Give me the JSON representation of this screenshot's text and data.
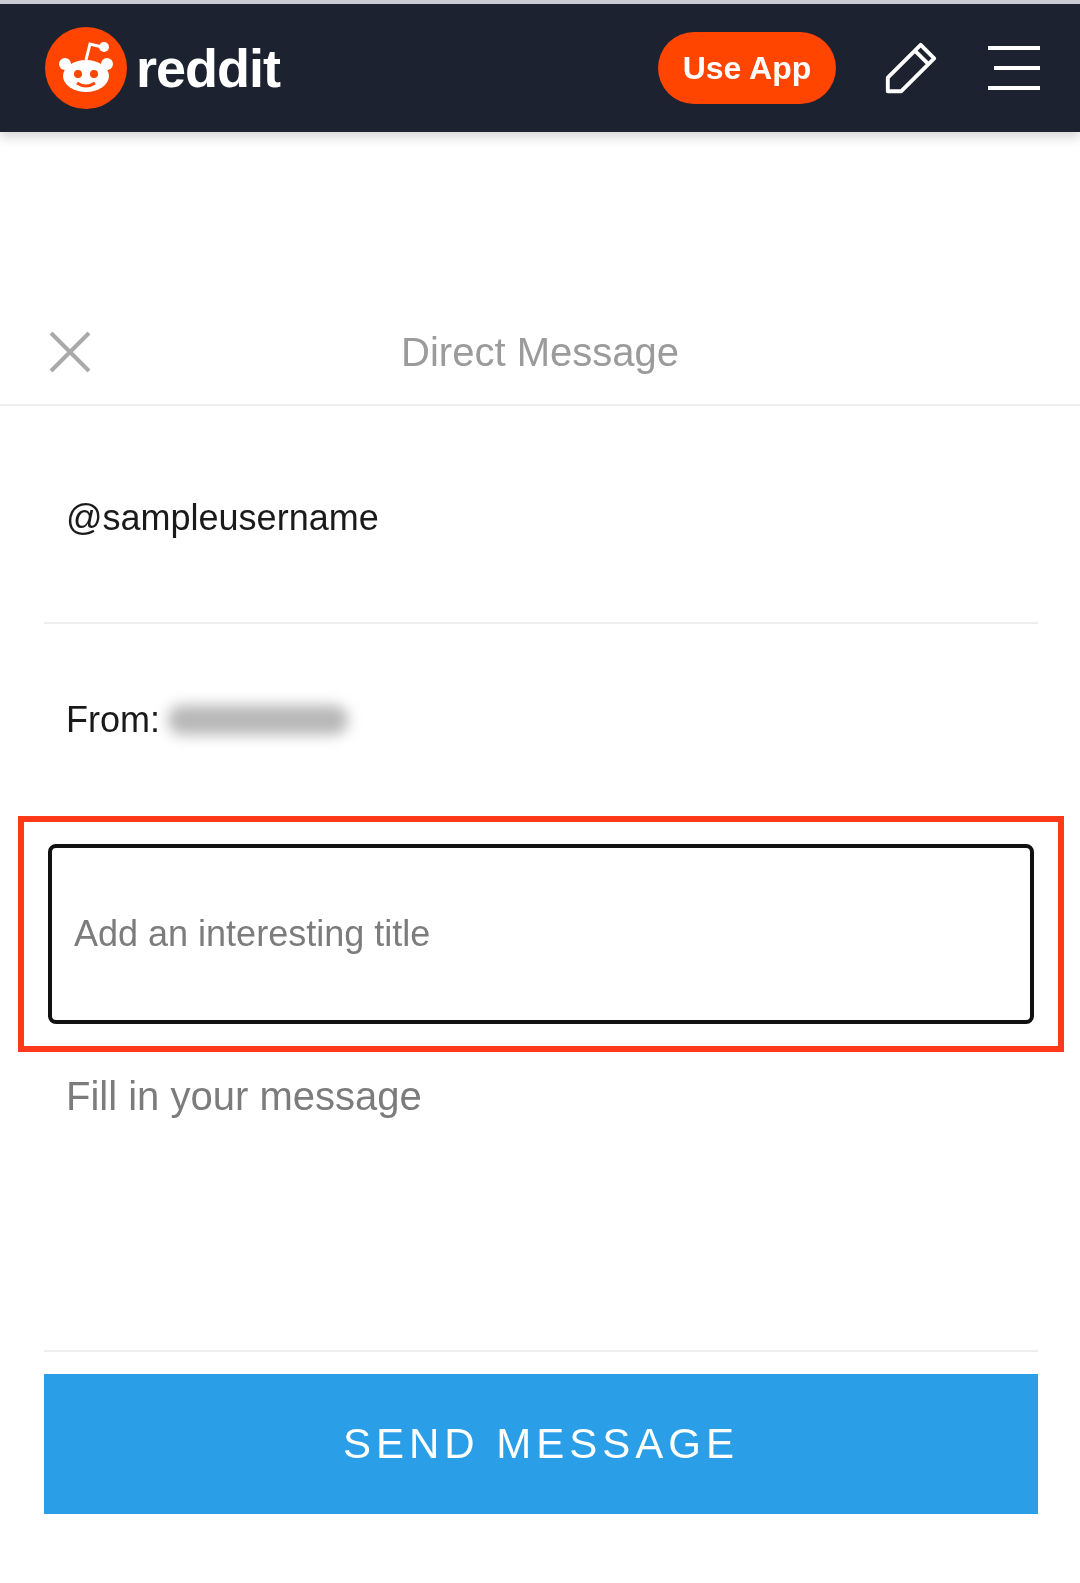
{
  "header": {
    "logo_text": "reddit",
    "use_app_button": "Use App"
  },
  "dialog": {
    "title": "Direct Message"
  },
  "recipient": {
    "value": "@sampleusername"
  },
  "sender": {
    "label": "From:"
  },
  "title_field": {
    "placeholder": "Add an interesting title",
    "highlighted": true
  },
  "message_field": {
    "placeholder": "Fill in your message"
  },
  "send_button": "SEND MESSAGE"
}
